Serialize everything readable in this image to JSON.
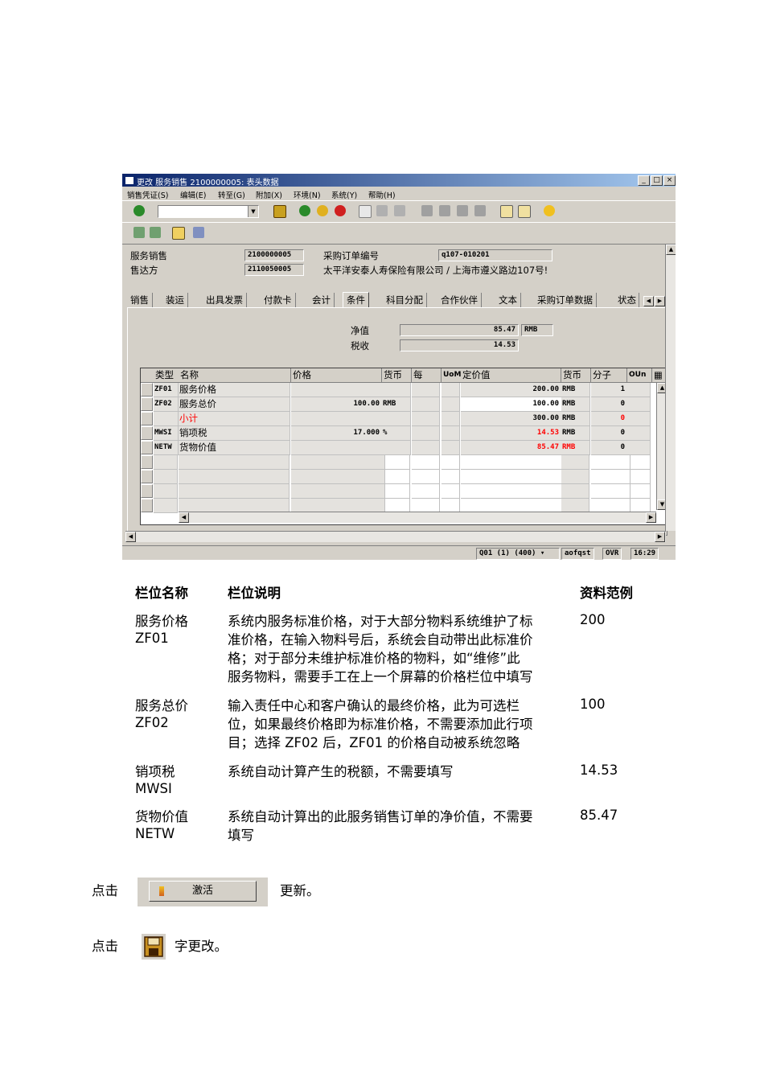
{
  "window": {
    "title": "更改 服务销售 2100000005: 表头数据",
    "buttons": [
      "_",
      "□",
      "×"
    ]
  },
  "menu": [
    "销售凭证(S)",
    "编辑(E)",
    "转至(G)",
    "附加(X)",
    "环境(N)",
    "系统(Y)",
    "帮助(H)"
  ],
  "header": {
    "doc_label": "服务销售",
    "doc_no": "2100000005",
    "sold_to_label": "售达方",
    "sold_to_no": "2110050005",
    "po_label": "采购订单编号",
    "po_no": "q107-010201",
    "sold_to_name": "太平洋安泰人寿保险有限公司 / 上海市遵义路边107号!"
  },
  "tabs": [
    "销售",
    "装运",
    "出具发票",
    "付款卡",
    "会计",
    "条件",
    "科目分配",
    "合作伙伴",
    "文本",
    "采购订单数据",
    "状态"
  ],
  "active_tab": "条件",
  "totals": {
    "net_label": "净值",
    "net_value": "85.47",
    "net_currency": "RMB",
    "tax_label": "税收",
    "tax_value": "14.53"
  },
  "grid": {
    "columns": [
      "类型",
      "名称",
      "价格",
      "货币",
      "每",
      "UoM",
      "定价值",
      "货币",
      "分子",
      "OUn"
    ],
    "rows": [
      {
        "type": "ZF01",
        "name": "服务价格",
        "price": "",
        "cur": "",
        "per": "",
        "uom": "",
        "value": "200.00",
        "vcur": "RMB",
        "num": "1"
      },
      {
        "type": "ZF02",
        "name": "服务总价",
        "price": "100.00",
        "cur": "RMB",
        "per": "",
        "uom": "",
        "value": "100.00",
        "vcur": "RMB",
        "num": "0"
      },
      {
        "type": "",
        "name": "小计",
        "price": "",
        "cur": "",
        "per": "",
        "uom": "",
        "value": "300.00",
        "vcur": "RMB",
        "num": "0"
      },
      {
        "type": "MWSI",
        "name": "销项税",
        "price": "17.000",
        "cur": "%",
        "per": "",
        "uom": "",
        "value": "14.53",
        "vcur": "RMB",
        "num": "0"
      },
      {
        "type": "NETW",
        "name": "货物价值",
        "price": "",
        "cur": "",
        "per": "",
        "uom": "",
        "value": "85.47",
        "vcur": "RMB",
        "num": "0"
      }
    ]
  },
  "status": {
    "system": "Q01 (1) (400)",
    "server": "aofqst",
    "mode": "OVR",
    "time": "16:29"
  },
  "doc_table": {
    "headers": [
      "栏位名称",
      "栏位说明",
      "资料范例"
    ],
    "rows": [
      {
        "name1": "服务价格",
        "name2": "ZF01",
        "desc": [
          "系统内服务标准价格，对于大部分物料系统维护了标",
          "准价格，在输入物料号后，系统会自动带出此标准价",
          "格；对于部分未维护标准价格的物料，如“维修”此",
          "服务物料，需要手工在上一个屏幕的价格栏位中填写"
        ],
        "example": "200"
      },
      {
        "name1": "服务总价",
        "name2": "ZF02",
        "desc": [
          "输入责任中心和客户确认的最终价格，此为可选栏",
          "位，如果最终价格即为标准价格，不需要添加此行项",
          "目；选择 ZF02 后，ZF01 的价格自动被系统忽略"
        ],
        "example": "100"
      },
      {
        "name1": "销项税",
        "name2": "MWSI",
        "desc": [
          "系统自动计算产生的税额，不需要填写"
        ],
        "example": "14.53"
      },
      {
        "name1": "货物价值",
        "name2": "NETW",
        "desc": [
          "系统自动计算出的此服务销售订单的净价值，不需要",
          "填写"
        ],
        "example": "85.47"
      }
    ]
  },
  "steps": {
    "click1": "点击",
    "activate_label": "激活",
    "after1": "更新。",
    "click2": "点击",
    "after2": "字更改。"
  }
}
